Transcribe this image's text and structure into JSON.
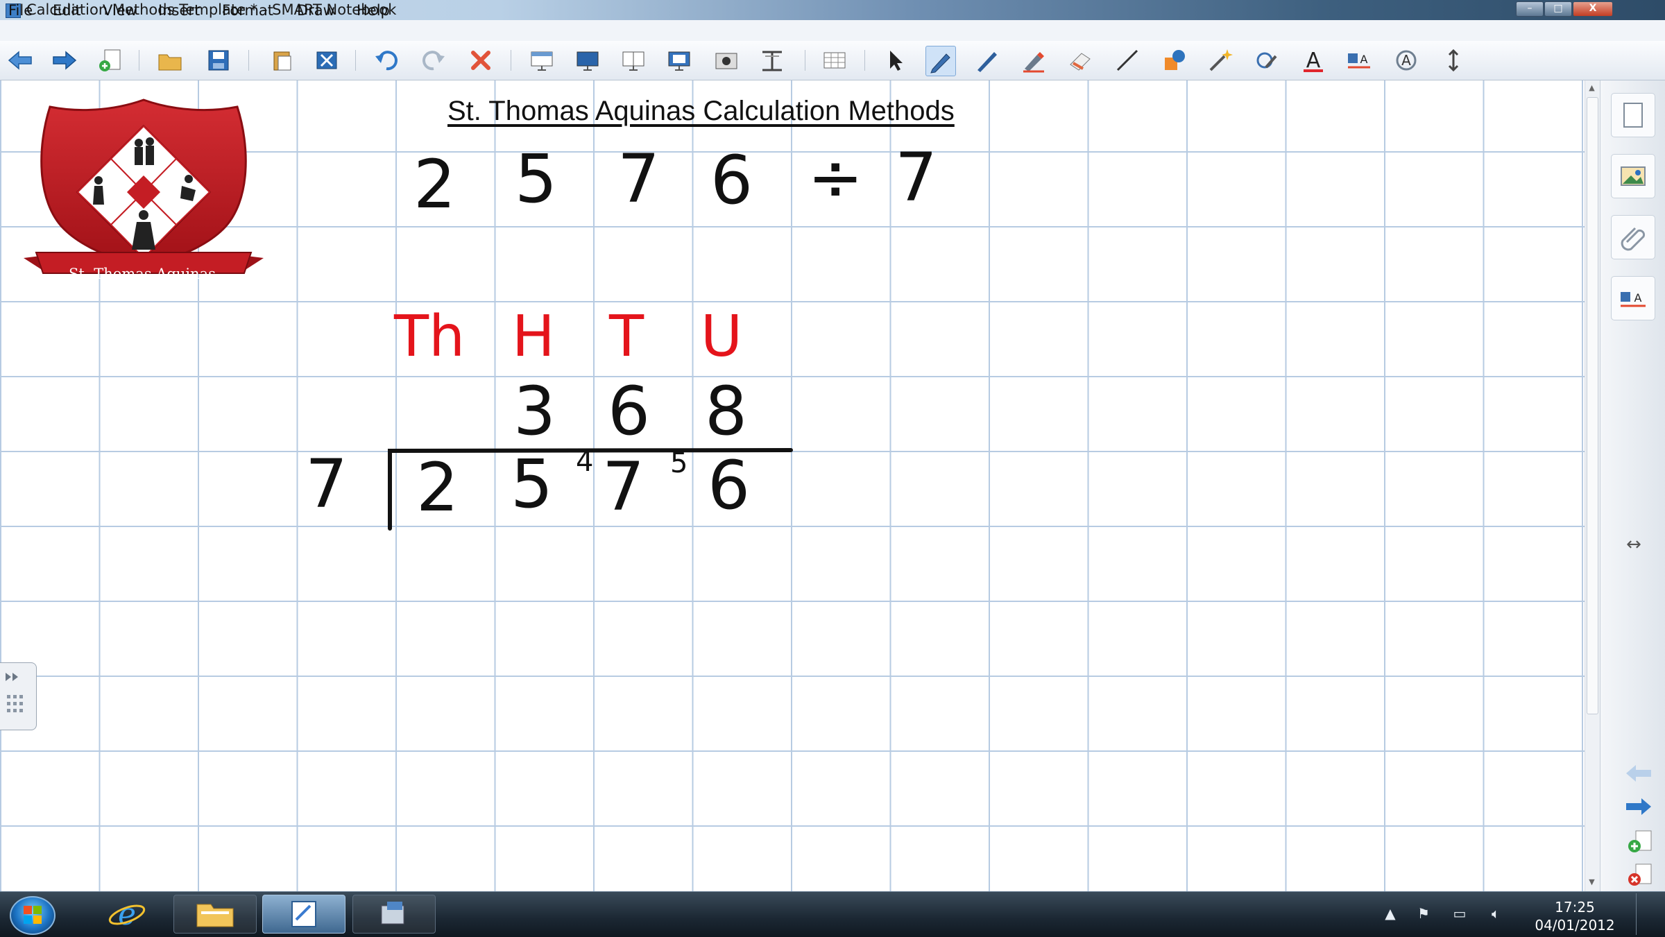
{
  "window": {
    "title": "Calculation Methods Template * - SMART Notebook",
    "controls": {
      "minimize": "–",
      "maximize": "□",
      "close": "X"
    }
  },
  "menu": [
    "File",
    "Edit",
    "View",
    "Insert",
    "Format",
    "Draw",
    "Help"
  ],
  "toolbar_icons": [
    "back-arrow-icon",
    "forward-arrow-icon",
    "add-page-icon",
    "open-folder-icon",
    "save-icon",
    "paste-icon",
    "delete-page-icon",
    "undo-icon",
    "redo-icon",
    "delete-icon",
    "screen-shade-icon",
    "full-screen-icon",
    "dual-page-icon",
    "capture-icon",
    "insert-image-icon",
    "table-tool-icon",
    "insert-table-icon",
    "select-arrow-icon",
    "pen-icon",
    "creative-pen-icon",
    "highlighter-icon",
    "eraser-icon",
    "line-icon",
    "shapes-icon",
    "magic-pen-icon",
    "shape-recognition-icon",
    "text-icon",
    "properties-icon",
    "fill-icon",
    "more-icon"
  ],
  "logo": {
    "banner_text": "St. Thomas Aquinas"
  },
  "page": {
    "title": "St. Thomas Aquinas Calculation Methods",
    "problem": {
      "digits": [
        "2",
        "5",
        "7",
        "6"
      ],
      "operator": "÷",
      "divisor": "7"
    },
    "place_values": [
      "Th",
      "H",
      "T",
      "U"
    ],
    "quotient": [
      "3",
      "6",
      "8"
    ],
    "division": {
      "divisor": "7",
      "dividend": [
        "2",
        "5",
        "7",
        "6"
      ],
      "carries": [
        "4",
        "5"
      ]
    }
  },
  "side_panel": [
    "page-sorter-icon",
    "gallery-icon",
    "attachments-icon",
    "properties-icon"
  ],
  "taskbar": {
    "clock_time": "17:25",
    "clock_date": "04/01/2012"
  },
  "colors": {
    "accent_red": "#e4141b",
    "grid": "#b7cbe2",
    "taskbar": "#1b2733"
  }
}
